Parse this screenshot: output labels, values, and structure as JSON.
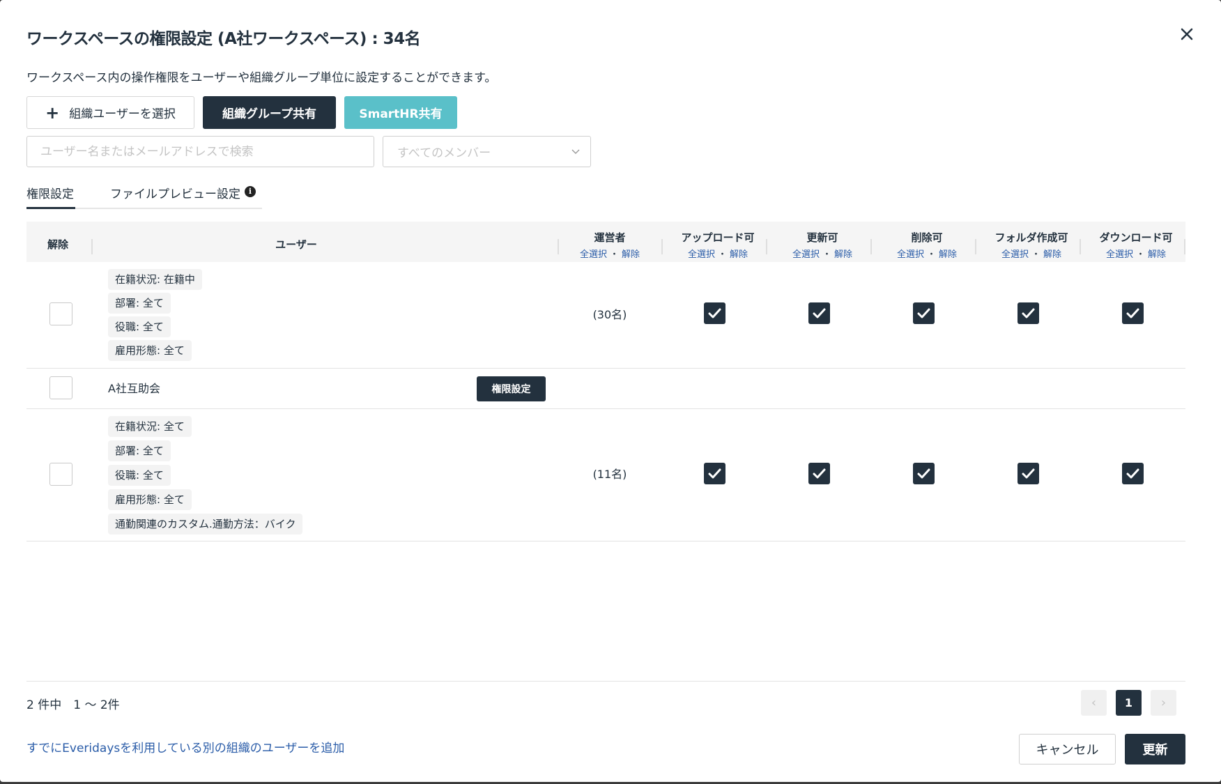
{
  "modal": {
    "title": "ワークスペースの権限設定 (A社ワークスペース) : 34名",
    "description": "ワークスペース内の操作権限をユーザーや組織グループ単位に設定することができます。"
  },
  "toolbar": {
    "select_users_label": "組織ユーザーを選択",
    "group_share_label": "組織グループ共有",
    "smarthr_share_label": "SmartHR共有"
  },
  "filters": {
    "search_placeholder": "ユーザー名またはメールアドレスで検索",
    "member_filter_value": "すべてのメンバー"
  },
  "tabs": [
    {
      "label": "権限設定",
      "active": true
    },
    {
      "label": "ファイルプレビュー設定",
      "active": false
    }
  ],
  "table": {
    "col_remove": "解除",
    "col_user": "ユーザー",
    "select_all": "全選択",
    "dot": "・",
    "deselect": "解除",
    "permission_columns": [
      "運営者",
      "アップロード可",
      "更新可",
      "削除可",
      "フォルダ作成可",
      "ダウンロード可"
    ],
    "rows": [
      {
        "type": "condition-group",
        "chips": [
          "在籍状況: 在籍中",
          "部署: 全て",
          "役職: 全て",
          "雇用形態: 全て"
        ],
        "count": "(30名)",
        "permissions": [
          true,
          true,
          true,
          true,
          true
        ]
      },
      {
        "type": "group",
        "name": "A社互助会",
        "action_label": "権限設定"
      },
      {
        "type": "condition-group",
        "chips": [
          "在籍状況: 全て",
          "部署: 全て",
          "役職: 全て",
          "雇用形態: 全て",
          "通勤関連のカスタム.通勤方法：バイク"
        ],
        "count": "(11名)",
        "permissions": [
          true,
          true,
          true,
          true,
          true
        ]
      }
    ]
  },
  "pagination": {
    "summary": "2 件中　1 〜 2件",
    "current_page": "1",
    "prev_symbol": "‹",
    "next_symbol": "›"
  },
  "footer": {
    "add_other_org_link": "すでにEveridaysを利用している別の組織のユーザーを追加",
    "cancel_label": "キャンセル",
    "update_label": "更新"
  },
  "colors": {
    "primary": "#23313e",
    "accent_teal": "#5ac0c9",
    "link": "#2a5ca8"
  }
}
